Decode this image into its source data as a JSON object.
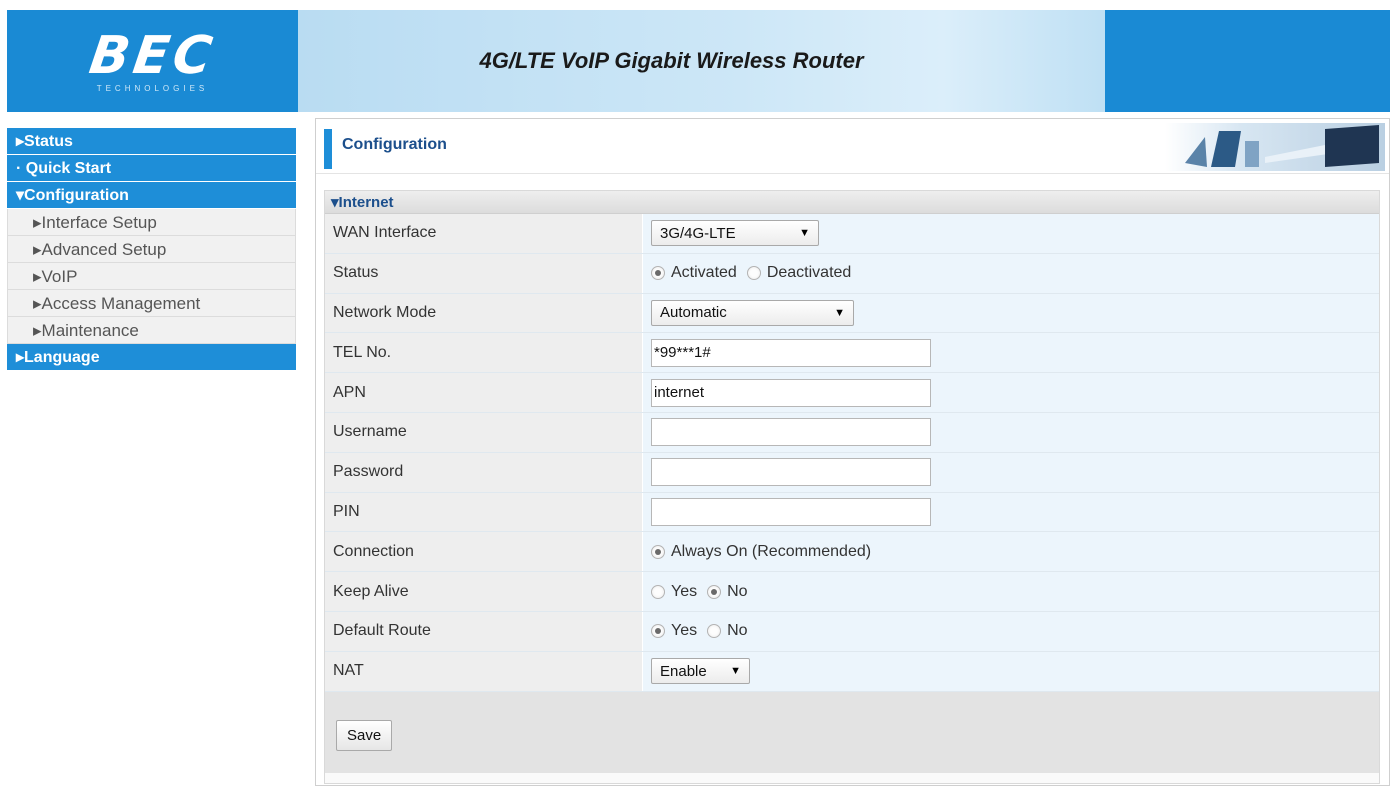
{
  "header": {
    "logo": "BEC",
    "logo_sub": "TECHNOLOGIES",
    "title": "4G/LTE VoIP Gigabit Wireless Router"
  },
  "sidebar": {
    "items": [
      {
        "label": "▸Status",
        "type": "main"
      },
      {
        "label": "· Quick Start",
        "type": "main"
      },
      {
        "label": "▾Configuration",
        "type": "main"
      },
      {
        "label": "▸Interface Setup",
        "type": "sub"
      },
      {
        "label": "▸Advanced Setup",
        "type": "sub"
      },
      {
        "label": "▸VoIP",
        "type": "sub"
      },
      {
        "label": "▸Access Management",
        "type": "sub"
      },
      {
        "label": "▸Maintenance",
        "type": "sub"
      },
      {
        "label": "▸Language",
        "type": "main"
      }
    ]
  },
  "page": {
    "title": "Configuration",
    "section_title": "▾Internet"
  },
  "form": {
    "wan_interface": {
      "label": "WAN Interface",
      "value": "3G/4G-LTE"
    },
    "status": {
      "label": "Status",
      "opt1": "Activated",
      "opt2": "Deactivated",
      "selected": "Activated"
    },
    "network_mode": {
      "label": "Network Mode",
      "value": "Automatic"
    },
    "tel_no": {
      "label": "TEL No.",
      "value": "*99***1#"
    },
    "apn": {
      "label": "APN",
      "value": "internet"
    },
    "username": {
      "label": "Username",
      "value": ""
    },
    "password": {
      "label": "Password",
      "value": ""
    },
    "pin": {
      "label": "PIN",
      "value": ""
    },
    "connection": {
      "label": "Connection",
      "opt1": "Always On (Recommended)",
      "selected": "Always On (Recommended)"
    },
    "keep_alive": {
      "label": "Keep Alive",
      "opt1": "Yes",
      "opt2": "No",
      "selected": "No"
    },
    "default_route": {
      "label": "Default Route",
      "opt1": "Yes",
      "opt2": "No",
      "selected": "Yes"
    },
    "nat": {
      "label": "NAT",
      "value": "Enable"
    }
  },
  "actions": {
    "save_label": "Save"
  },
  "colors": {
    "brand_blue": "#1e8ed8",
    "header_light": "#cde7f7",
    "title_blue": "#1c4f8c"
  }
}
